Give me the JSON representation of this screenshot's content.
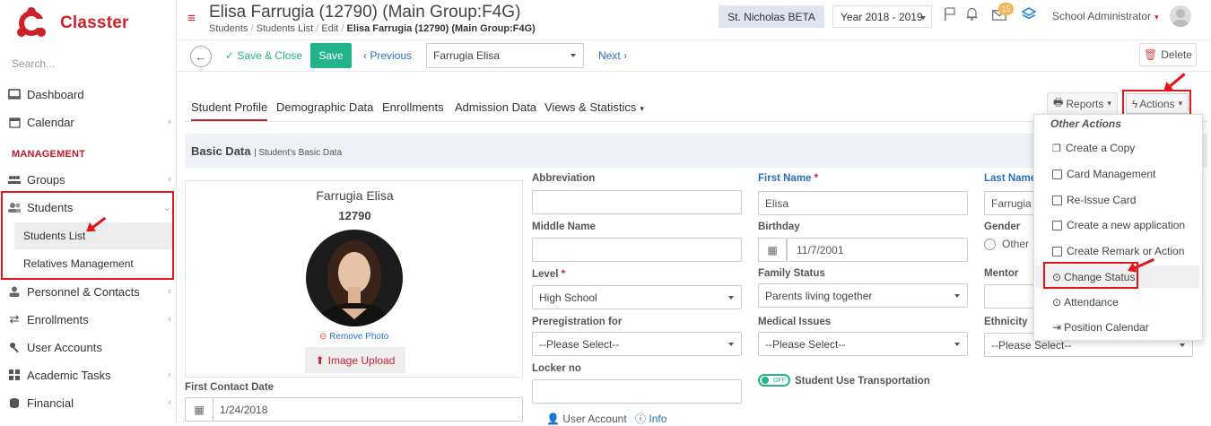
{
  "sidebar": {
    "logo_text": "Classter",
    "search_placeholder": "Search...",
    "management_label": "MANAGEMENT",
    "items": {
      "dashboard": "Dashboard",
      "calendar": "Calendar",
      "groups": "Groups",
      "students": "Students",
      "students_list": "Students List",
      "relatives": "Relatives Management",
      "personnel": "Personnel & Contacts",
      "enrollments": "Enrollments",
      "user_accounts": "User Accounts",
      "academic_tasks": "Academic Tasks",
      "financial": "Financial"
    }
  },
  "header": {
    "title": "Elisa Farrugia (12790) (Main Group:F4G)",
    "breadcrumb": [
      "Students",
      "Students List",
      "Edit",
      "Elisa Farrugia (12790) (Main Group:F4G)"
    ],
    "breadcrumb_sep": "/",
    "school": "St. Nicholas BETA",
    "year": "Year 2018 - 2019",
    "mail_badge": "15",
    "user": "School Administrator"
  },
  "toolbar": {
    "save_close": "Save & Close",
    "save": "Save",
    "previous": "Previous",
    "student_select": "Farrugia Elisa",
    "next": "Next",
    "delete": "Delete"
  },
  "tabs": [
    "Student Profile",
    "Demographic Data",
    "Enrollments",
    "Admission Data",
    "Views & Statistics"
  ],
  "actions": {
    "reports": "Reports",
    "actions": "Actions",
    "menu_header": "Other Actions",
    "menu_items": [
      "Create a Copy",
      "Card Management",
      "Re-Issue Card",
      "Create a new application",
      "Create Remark or Action",
      "Change Status",
      "Attendance",
      "Position Calendar"
    ]
  },
  "section": {
    "title": "Basic Data",
    "subtitle": "| Student's Basic Data"
  },
  "profile": {
    "name": "Farrugia Elisa",
    "id": "12790",
    "remove_photo": "Remove Photo",
    "image_upload": "Image Upload"
  },
  "form": {
    "first_contact_label": "First Contact Date",
    "first_contact_value": "1/24/2018",
    "abbreviation_label": "Abbreviation",
    "abbreviation_value": "",
    "middle_name_label": "Middle Name",
    "middle_name_value": "",
    "level_label": "Level",
    "level_value": "High School",
    "prereg_label": "Preregistration for",
    "prereg_value": "--Please Select--",
    "locker_label": "Locker no",
    "locker_value": "",
    "user_account_label": "User Account",
    "info_label": "Info",
    "first_name_label": "First Name",
    "first_name_value": "Elisa",
    "birthday_label": "Birthday",
    "birthday_value": "11/7/2001",
    "family_status_label": "Family Status",
    "family_status_value": "Parents living together",
    "medical_label": "Medical Issues",
    "medical_value": "--Please Select--",
    "transport_toggle": "OFF",
    "transport_label": "Student Use Transportation",
    "last_name_label": "Last Name",
    "last_name_value": "Farrugia",
    "gender_label": "Gender",
    "gender_value": "Other",
    "mentor_label": "Mentor",
    "ethnicity_label": "Ethnicity",
    "ethnicity_value": "--Please Select--",
    "required_mark": "*"
  },
  "colors": {
    "brand_red": "#d0212a",
    "save_green": "#23b38a",
    "highlight_red": "#e8141c",
    "link_blue": "#2b6fc0"
  }
}
